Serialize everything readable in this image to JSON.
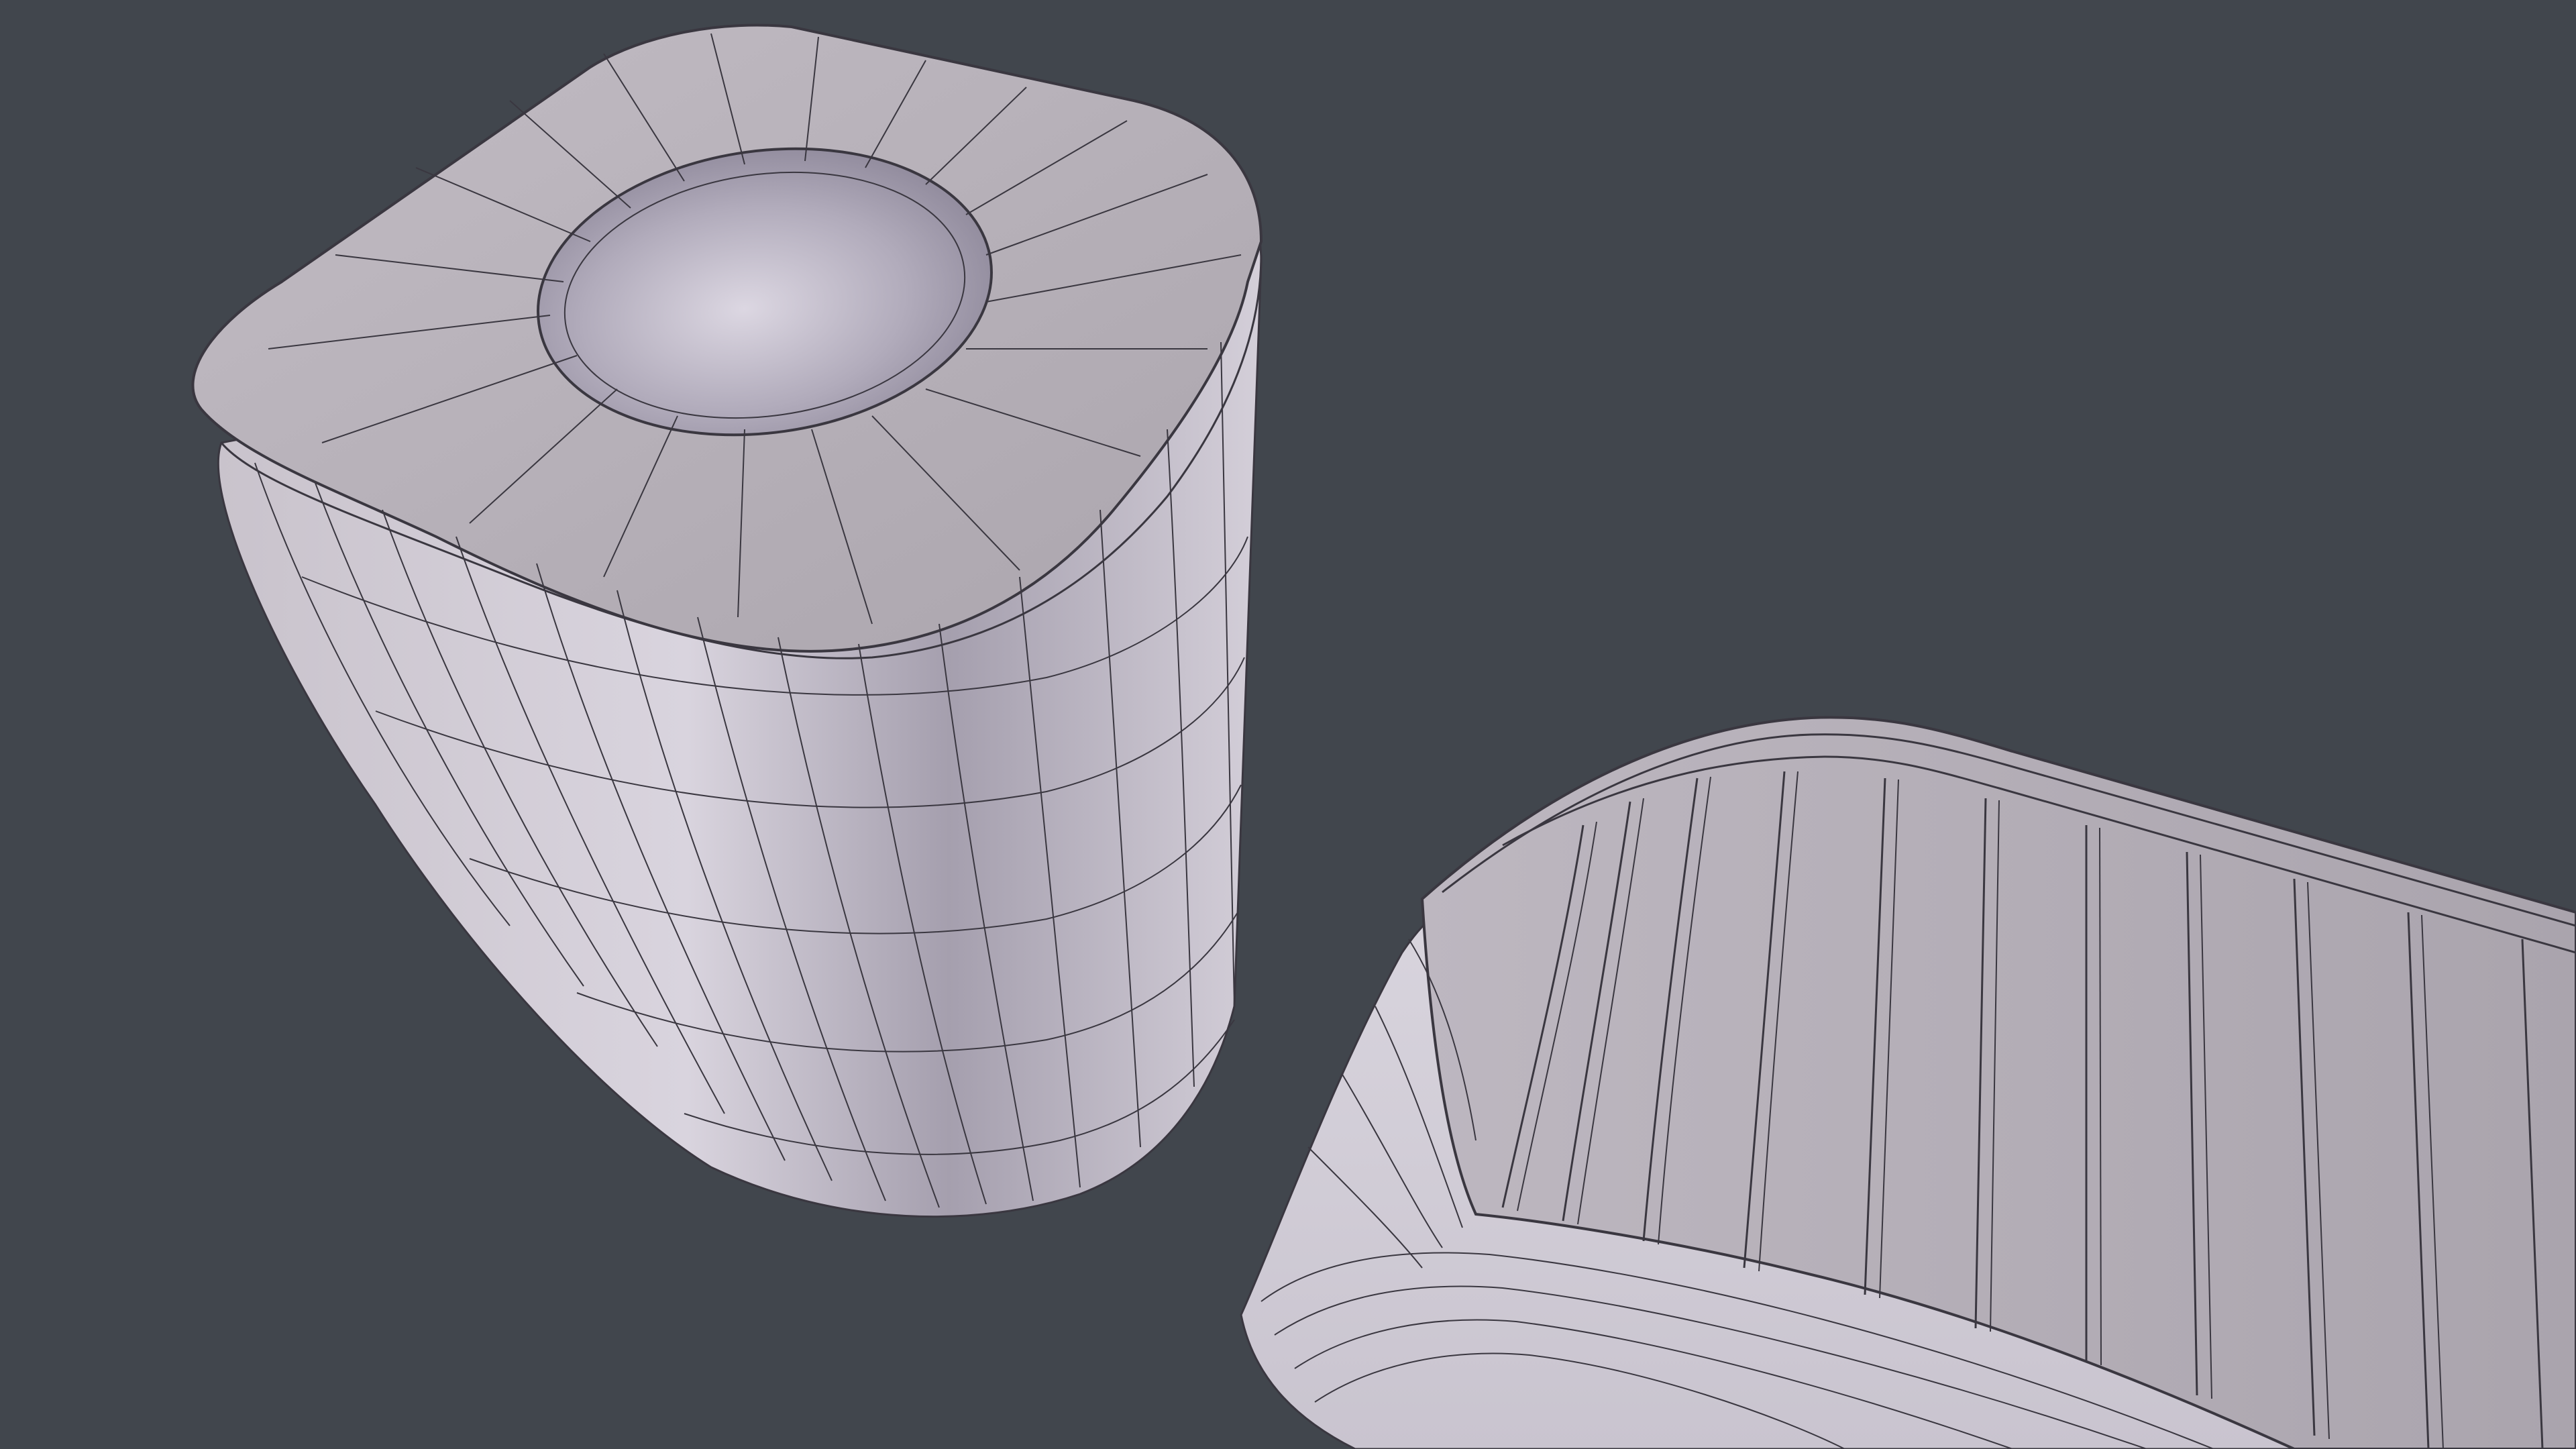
{
  "viewport": {
    "background_color": "#41464d"
  },
  "materials": {
    "surface_light": "#d2ccd4",
    "surface_mid": "#b6b0b9",
    "surface_shadow": "#8f899a",
    "wire_color": "#3a3740"
  },
  "objects": [
    {
      "id": "cup",
      "description_icon": "hollow-cup-mesh-icon"
    },
    {
      "id": "tray",
      "description_icon": "slatted-tray-mesh-icon"
    }
  ]
}
